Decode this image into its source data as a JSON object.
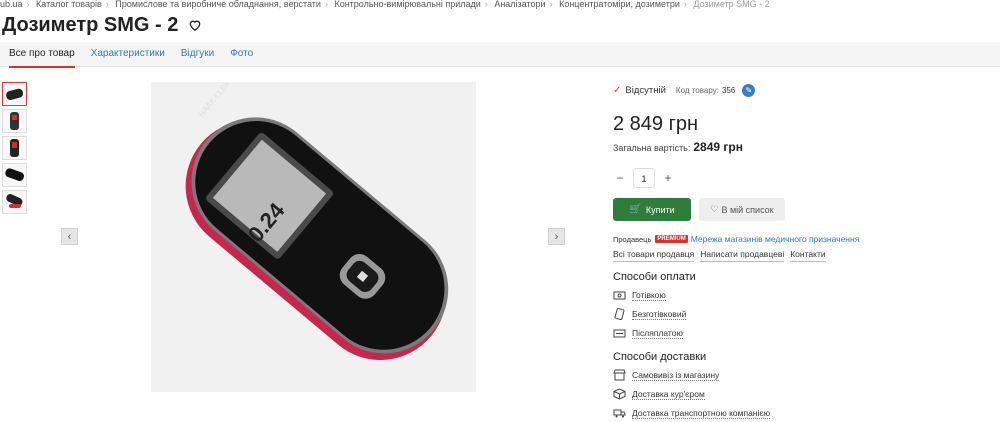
{
  "breadcrumb": {
    "items": [
      "ub.ua",
      "Каталог товарів",
      "Промислове та виробниче обладнання, верстати",
      "Контрольно-вимірювальні прилади",
      "Аналізатори",
      "Концентратоміри, дозиметри"
    ],
    "current": "Дозиметр SMG - 2"
  },
  "product": {
    "title": "Дозиметр SMG - 2"
  },
  "tabs": [
    "Все про товар",
    "Характеристики",
    "Відгуки",
    "Фото"
  ],
  "photo": {
    "brand_text": "HAAK ELEKTRONIK",
    "display_value": "0.24"
  },
  "info": {
    "stock": "Відсутній",
    "code_label": "Код товару:",
    "code_value": "356",
    "price": "2 849 грн",
    "total_label": "Загальна вартість:",
    "total_value": "2849 грн",
    "quantity": "1",
    "minus": "−",
    "plus": "+",
    "buy_label": "Купити",
    "wish_label": "В мій список",
    "seller_label": "Продавець",
    "premium": "PREMIUM",
    "seller_name": "Мережа магазинів медичного призначення",
    "seller_links": [
      "Всі товари продавця",
      "Написати продавцеві",
      "Контакти"
    ],
    "payment_title": "Способи оплати",
    "payment_methods": [
      "Готівкою",
      "Безготівковий",
      "Післяплатою"
    ],
    "delivery_title": "Способи доставки",
    "delivery_methods": [
      "Самовивіз із магазину",
      "Доставка кур'єром",
      "Доставка транспортною компанією"
    ]
  },
  "colors": {
    "accent_red": "#d9342b",
    "buy_green": "#2e7d3a",
    "link_blue": "#2a7ab8"
  }
}
